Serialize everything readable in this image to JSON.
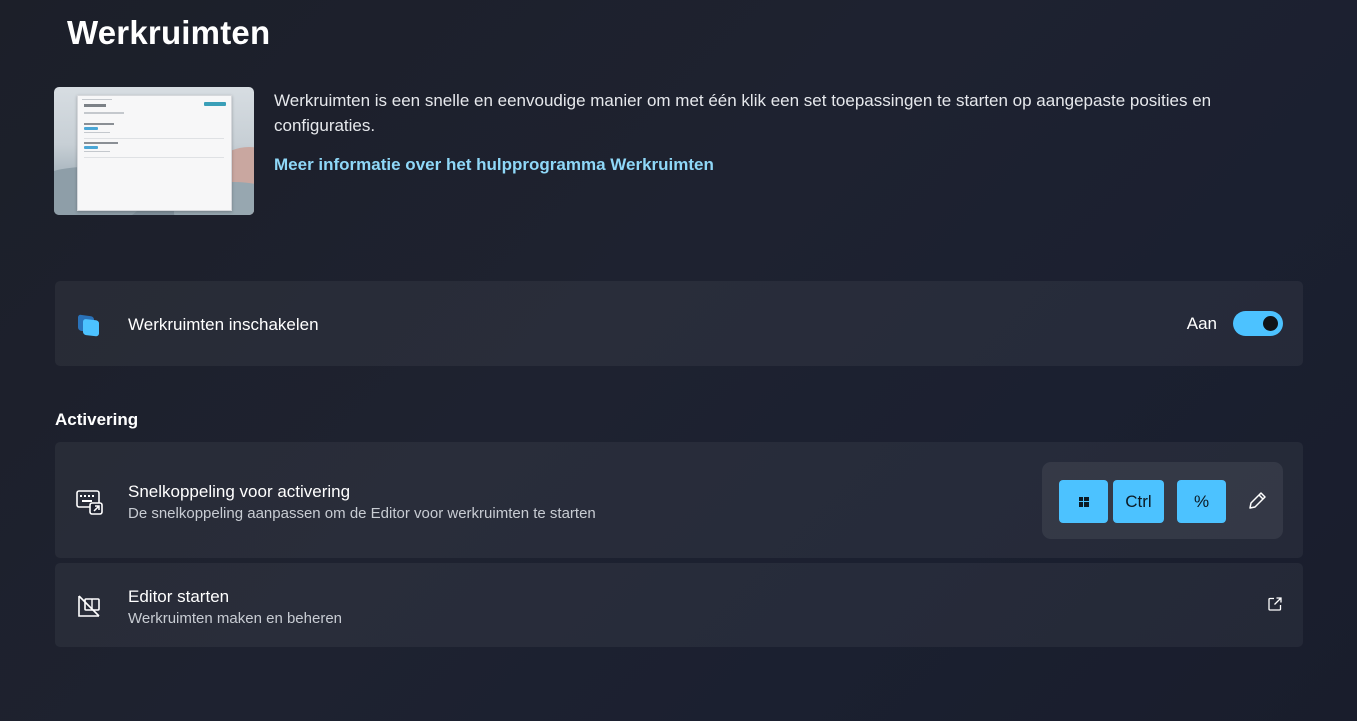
{
  "page": {
    "title": "Werkruimten"
  },
  "hero": {
    "image_icon": "workspaces-preview-image",
    "description": "Werkruimten is een snelle en eenvoudige manier om met één klik een set toepassingen te starten op aangepaste posities en configuraties.",
    "link_text": "Meer informatie over het hulpprogramma Werkruimten"
  },
  "enable": {
    "icon": "workspaces-icon",
    "title": "Werkruimten inschakelen",
    "state_label": "Aan",
    "is_on": true
  },
  "activation": {
    "heading": "Activering",
    "shortcut": {
      "icon": "keyboard-shortcut-icon",
      "title": "Snelkoppeling voor activering",
      "subtitle": "De snelkoppeling aanpassen om de Editor voor werkruimten te starten",
      "keys": [
        "windows-logo-key",
        "Ctrl",
        "%"
      ],
      "key_ctrl": "Ctrl",
      "key_percent": "%",
      "edit_icon": "pencil-icon"
    },
    "editor": {
      "icon": "editor-layout-icon",
      "title": "Editor starten",
      "subtitle": "Werkruimten maken en beheren",
      "launch_icon": "external-link-icon"
    }
  },
  "colors": {
    "accent": "#4cc2ff",
    "link": "#8fd8f8",
    "background": "#1e2230",
    "card": "#272b37"
  }
}
